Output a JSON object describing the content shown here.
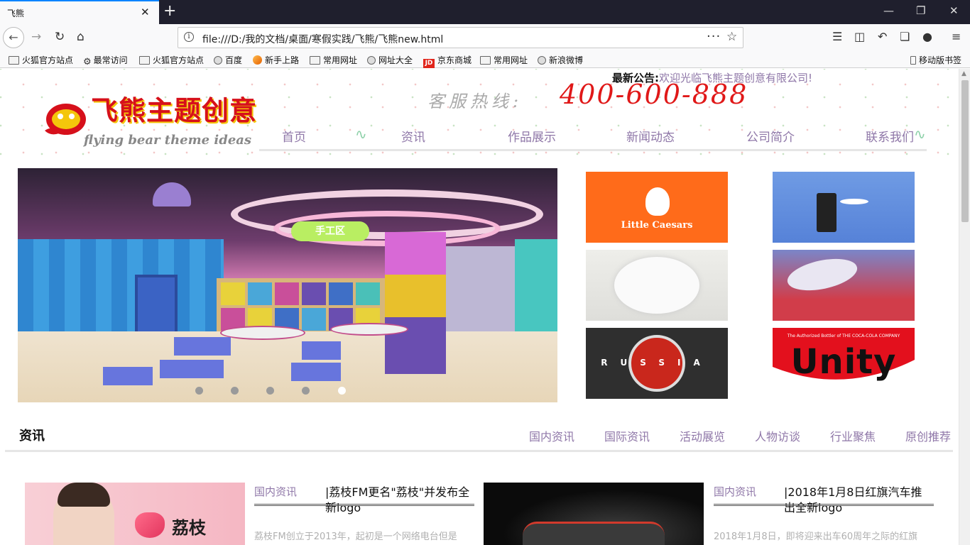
{
  "browser": {
    "tab_title": "飞熊",
    "tab_close": "✕",
    "new_tab": "+",
    "url": "file:///D:/我的文档/桌面/寒假实践/飞熊/飞熊new.html",
    "bookmarks": [
      {
        "label": "火狐官方站点",
        "icon": "folder-icon"
      },
      {
        "label": "最常访问",
        "icon": "gear-icon"
      },
      {
        "label": "火狐官方站点",
        "icon": "folder-icon"
      },
      {
        "label": "百度",
        "icon": "globe-icon"
      },
      {
        "label": "新手上路",
        "icon": "firefox-icon"
      },
      {
        "label": "常用网址",
        "icon": "folder-icon"
      },
      {
        "label": "网址大全",
        "icon": "globe-icon"
      },
      {
        "label": "京东商城",
        "icon": "jd-icon"
      },
      {
        "label": "常用网址",
        "icon": "folder-icon"
      },
      {
        "label": "新浪微博",
        "icon": "globe-icon"
      }
    ],
    "mobile_bookmarks": "移动版书签"
  },
  "site": {
    "logo_cn": "飞熊主题创意",
    "logo_en": "flying bear theme ideas",
    "notice_label": "最新公告:",
    "notice_text": "欢迎光临飞熊主题创意有限公司!",
    "hotline_label": "客服热线:",
    "hotline_number": "400-600-888",
    "nav": [
      "首页",
      "资讯",
      "作品展示",
      "新闻动态",
      "公司简介",
      "联系我们"
    ],
    "banner_sign": "手工区",
    "banner_slides": 5,
    "banner_active_slide": 5,
    "thumbs": {
      "little_caesars": "Little Caesars",
      "russia": "RUSSIA",
      "unity_small": "The Authorized Bottler of THE COCA-COLA COMPANY",
      "unity": "Unity"
    }
  },
  "news": {
    "section_title": "资讯",
    "categories": [
      "国内资讯",
      "国际资讯",
      "活动展览",
      "人物访谈",
      "行业聚焦",
      "原创推荐"
    ],
    "items": [
      {
        "category": "国内资讯",
        "title": "|荔枝FM更名\"荔枝\"并发布全新logo",
        "desc": "荔枝FM创立于2013年，起初是一个网络电台但是",
        "brand": "荔枝"
      },
      {
        "category": "国内资讯",
        "title": "|2018年1月8日红旗汽车推出全新logo",
        "desc": "2018年1月8日，即将迎来出车60周年之际的红旗"
      }
    ]
  }
}
